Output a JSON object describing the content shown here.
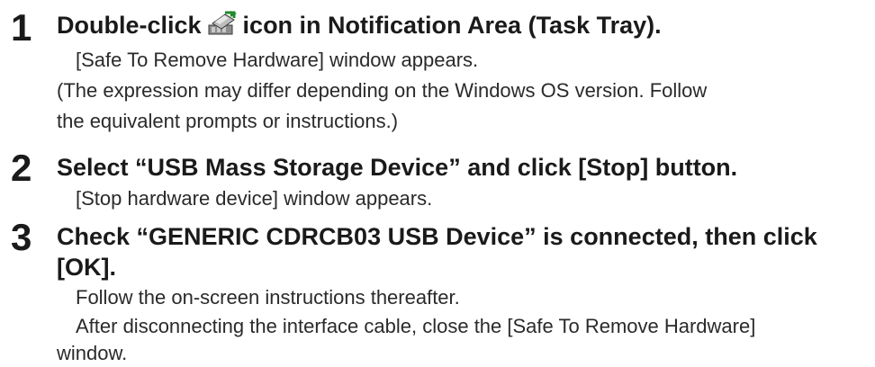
{
  "steps": [
    {
      "number": "1",
      "title_before_icon": "Double-click",
      "title_after_icon": "icon in Notification Area (Task Tray).",
      "icon": "safe-remove-hardware-icon",
      "lines": [
        "[Safe To Remove Hardware] window appears.",
        "(The expression may differ depending on the Windows OS version. Follow",
        "the equivalent prompts or instructions.)"
      ]
    },
    {
      "number": "2",
      "title": "Select “USB Mass Storage Device” and click [Stop] button.",
      "lines": [
        "[Stop hardware device] window appears."
      ]
    },
    {
      "number": "3",
      "title_line1": "Check “GENERIC CDRCB03 USB Device” is connected, then click",
      "title_line2": "[OK].",
      "lines": [
        "Follow the on-screen instructions thereafter.",
        "After disconnecting the interface cable, close the [Safe To Remove Hardware]",
        "window."
      ]
    }
  ]
}
